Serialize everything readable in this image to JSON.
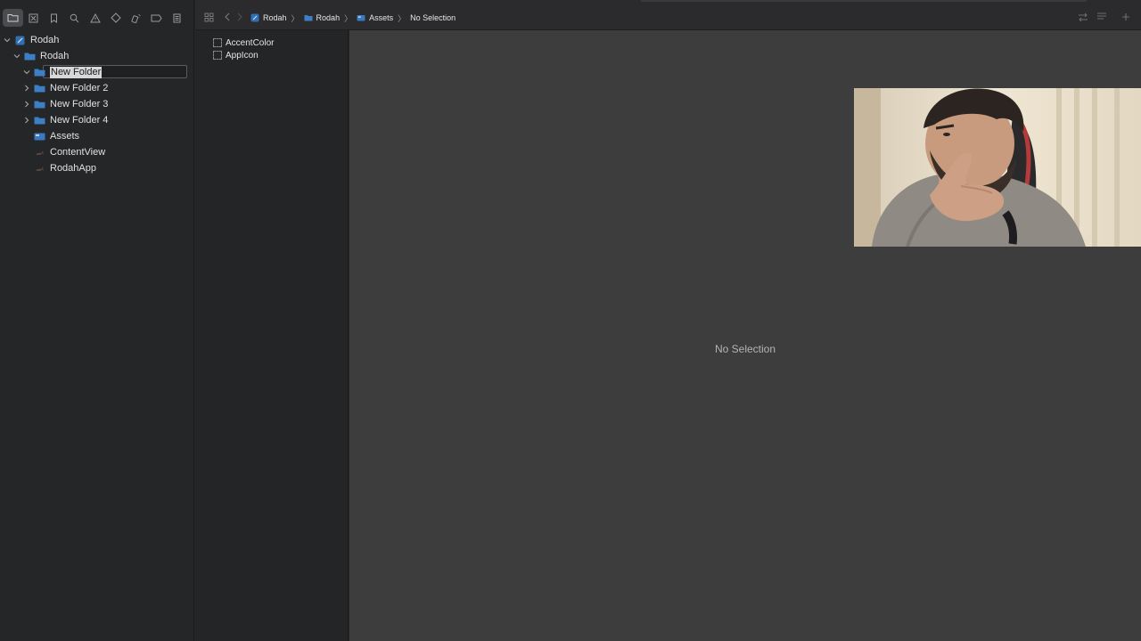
{
  "navigator": {
    "toolbar_icons": [
      "project-navigator-icon",
      "source-control-icon",
      "bookmark-icon",
      "find-icon",
      "issue-warning-icon",
      "test-diamond-icon",
      "debug-spray-icon",
      "breakpoint-icon",
      "report-icon"
    ],
    "tree": [
      {
        "label": "Rodah",
        "depth": 0,
        "expanded": true,
        "type": "project"
      },
      {
        "label": "Rodah",
        "depth": 1,
        "expanded": true,
        "type": "folder"
      },
      {
        "label": "New Folder",
        "depth": 2,
        "expanded": true,
        "type": "folder",
        "editing": true
      },
      {
        "label": "New Folder 2",
        "depth": 2,
        "expanded": false,
        "type": "folder"
      },
      {
        "label": "New Folder 3",
        "depth": 2,
        "expanded": false,
        "type": "folder"
      },
      {
        "label": "New Folder 4",
        "depth": 2,
        "expanded": false,
        "type": "folder"
      },
      {
        "label": "Assets",
        "depth": 2,
        "type": "assets"
      },
      {
        "label": "ContentView",
        "depth": 2,
        "type": "swift"
      },
      {
        "label": "RodahApp",
        "depth": 2,
        "type": "swift"
      }
    ]
  },
  "breadcrumb": {
    "items": [
      {
        "label": "Rodah",
        "icon": "xcode-project-icon"
      },
      {
        "label": "Rodah",
        "icon": "folder-icon"
      },
      {
        "label": "Assets",
        "icon": "asset-catalog-icon"
      },
      {
        "label": "No Selection",
        "icon": ""
      }
    ]
  },
  "asset_list": {
    "items": [
      "AccentColor",
      "AppIcon"
    ]
  },
  "editor": {
    "empty_state": "No Selection"
  },
  "colors": {
    "navigator_bg": "#252628",
    "editor_bg": "#3d3d3d",
    "folder_blue": "#3d7fc4",
    "selection": "#d8d8d8"
  }
}
